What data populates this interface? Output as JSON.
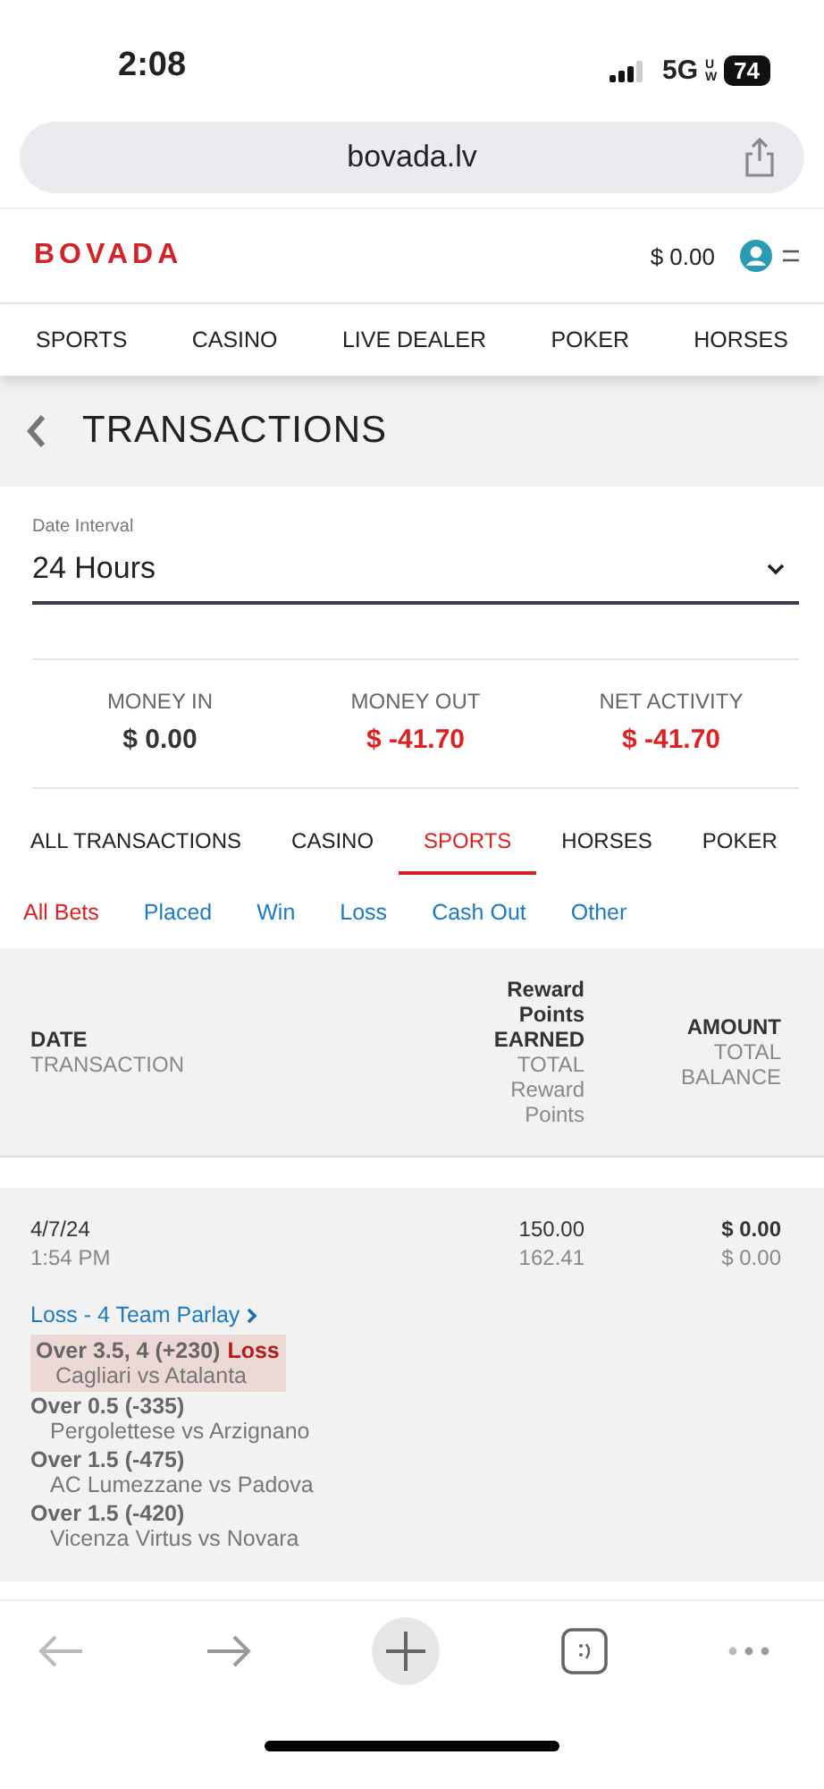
{
  "status_bar": {
    "time": "2:08",
    "network": "5G",
    "network_sub": "UW",
    "battery": "74"
  },
  "browser": {
    "url": "bovada.lv"
  },
  "header": {
    "logo": "BOVADA",
    "balance": "$ 0.00"
  },
  "nav": [
    "SPORTS",
    "CASINO",
    "LIVE DEALER",
    "POKER",
    "HORSES"
  ],
  "page_title": "TRANSACTIONS",
  "date_interval": {
    "label": "Date Interval",
    "value": "24 Hours"
  },
  "summary": [
    {
      "label": "MONEY IN",
      "value": "$ 0.00",
      "negative": false
    },
    {
      "label": "MONEY OUT",
      "value": "$ -41.70",
      "negative": true
    },
    {
      "label": "NET ACTIVITY",
      "value": "$ -41.70",
      "negative": true
    }
  ],
  "tabs": [
    {
      "label": "ALL TRANSACTIONS",
      "selected": false
    },
    {
      "label": "CASINO",
      "selected": false
    },
    {
      "label": "SPORTS",
      "selected": true
    },
    {
      "label": "HORSES",
      "selected": false
    },
    {
      "label": "POKER",
      "selected": false
    }
  ],
  "filters": [
    {
      "label": "All Bets",
      "selected": true
    },
    {
      "label": "Placed",
      "selected": false
    },
    {
      "label": "Win",
      "selected": false
    },
    {
      "label": "Loss",
      "selected": false
    },
    {
      "label": "Cash Out",
      "selected": false
    },
    {
      "label": "Other",
      "selected": false
    }
  ],
  "table": {
    "columns": [
      {
        "title": "DATE",
        "subtitle": "TRANSACTION"
      },
      {
        "title": "Reward Points EARNED",
        "subtitle": "TOTAL Reward Points"
      },
      {
        "title": "AMOUNT",
        "subtitle": "TOTAL BALANCE"
      }
    ],
    "rows": [
      {
        "date": "4/7/24",
        "time": "1:54 PM",
        "points": "150.00",
        "total_points": "162.41",
        "amount": "$ 0.00",
        "balance": "$ 0.00",
        "bet": "Loss - 4 Team Parlay",
        "legs": [
          {
            "pick": "Over 3.5, 4 (+230)",
            "result": "Loss",
            "match": "Cagliari vs Atalanta",
            "highlighted": true
          },
          {
            "pick": "Over 0.5 (-335)",
            "match": "Pergolettese vs Arzignano",
            "highlighted": false
          },
          {
            "pick": "Over 1.5 (-475)",
            "match": "AC Lumezzane vs Padova",
            "highlighted": false
          },
          {
            "pick": "Over 1.5 (-420)",
            "match": "Vicenza Virtus vs Novara",
            "highlighted": false
          }
        ]
      }
    ]
  }
}
